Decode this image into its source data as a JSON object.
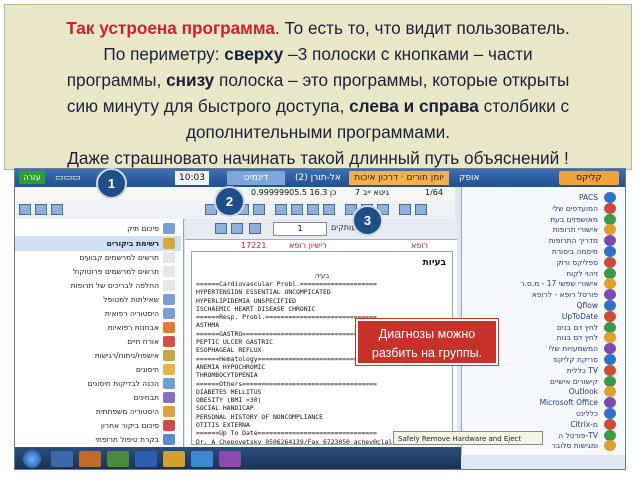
{
  "caption": {
    "line1_red": "Так устроена программа",
    "line1_rest": ". То есть то, что видит пользователь.",
    "line2_a": "По периметру: ",
    "line2_b": "сверху",
    "line2_c": " –3 полоски с кнопками – части",
    "line3_a": "программы, ",
    "line3_b": "снизу",
    "line3_c": " полоска – это программы, которые открыты",
    "line4_a": "сию минуту для быстрого доступа, ",
    "line4_b": "слева и справа",
    "line4_c": " столбики с",
    "line5": "дополнительными программами.",
    "line6": "Даже страшновато начинать такой длинный путь объяснений !"
  },
  "markers": {
    "m1": "1",
    "m2": "2",
    "m3": "3"
  },
  "note": {
    "line1": "Диагнозы можно",
    "line2": "разбить на группы."
  },
  "titlebar": {
    "green": "עזרה",
    "time": "10:03",
    "tab_dinamit": "דינמיט",
    "tab_alt": "אל-תורן (2)",
    "tab_yoman": "יומן תורים",
    "tab_drachim": "דרכון איכות",
    "tab_ofek": "אופק",
    "tab_clicks": "קליקס",
    "orange": "קליקס",
    "patient": "0.99999905.5 כן 16.3",
    "pat2": "גיטא ייב 7",
    "count": "1/64"
  },
  "main": {
    "pager_value": "1",
    "pager_label": "עותקים",
    "red_left": "17221",
    "red_mid": "רישיון רופא",
    "red_right": "רופא",
    "doc_title": "בעיות",
    "doc_sub": "בעיה",
    "doc_lines": [
      "======Cardiovascular Probl.====================",
      "HYPERTENSION ESSENTIAL UNCOMPICATED",
      "HYPERLIPIDEMIA UNSPECIFIED",
      "ISCHAEMIC HEART DISEASE CHRONIC",
      "======Resp. Probl.=============================",
      "ASTHMA",
      "======GASTRO===================================",
      "PEPTIC ULCER GASTRIC",
      "ESOPHAGEAL REFLUX",
      "======Hematology===============================",
      "ANEMIA HYPOCHROMIC",
      "THROMBOCYTOPENIA",
      "======Others===================================",
      "DIABETES MELLITUS",
      "OBESITY (BMI >30)",
      "SOCIAL HANDICAP",
      "PERSONAL HISTORY OF NONCOMPLIANCE",
      "OTITIS EXTERNA",
      "======Up To Date===============================",
      "Dr. A Chepovetsky 0506264139/Fax 6723050 achev@clalit.org"
    ]
  },
  "left_tree": [
    "סיכום תיק",
    "רשימת ביקורים",
    "תרשים למרשמים קבועים",
    "תרשים למרשמים פרוטוקול",
    "החלפה לבריכים של תרופות",
    "שאילתות למטופל",
    "היסטוריה רפואית",
    "אבחנות רפואיות",
    "אורח חיים",
    "אישפוז/ניתוח/רגישות",
    "חיסונים",
    "הכנה לבדיקות חיסונים",
    "תבחינים",
    "היסטוריה משפחתית",
    "סיכום ביקור אחרון",
    "בקרת טיפול תרופתי"
  ],
  "right_list": [
    "PACS",
    "המועדפים שלי",
    "מאושפזים בעת",
    "אישורי תרופות",
    "מדריך התרופות",
    "מיסמה ביסורת",
    "ספליקס ורוק",
    "זיהוי לקוח",
    "אישורי שפשי 17 - מ.ס.ר",
    "פורטל רופא - לרופא",
    "Qflow",
    "UpToDate",
    "לחץ דם בנים",
    "לחץ דם בנות",
    "המשמעויות שלי",
    "סריקת קליקס",
    "כללית TV",
    "קישורים אישיים",
    "Outlook",
    "Microsoft Office",
    "כללינט",
    "Citrix-מ",
    "פורטל ה-TV",
    "ומגישות סלובר"
  ],
  "safely": "Safely Remove Hardware and Eject Media",
  "colors": {
    "accent_red": "#c7312a",
    "caption_bg": "#e8e8c8",
    "marker": "#1f4f86"
  }
}
